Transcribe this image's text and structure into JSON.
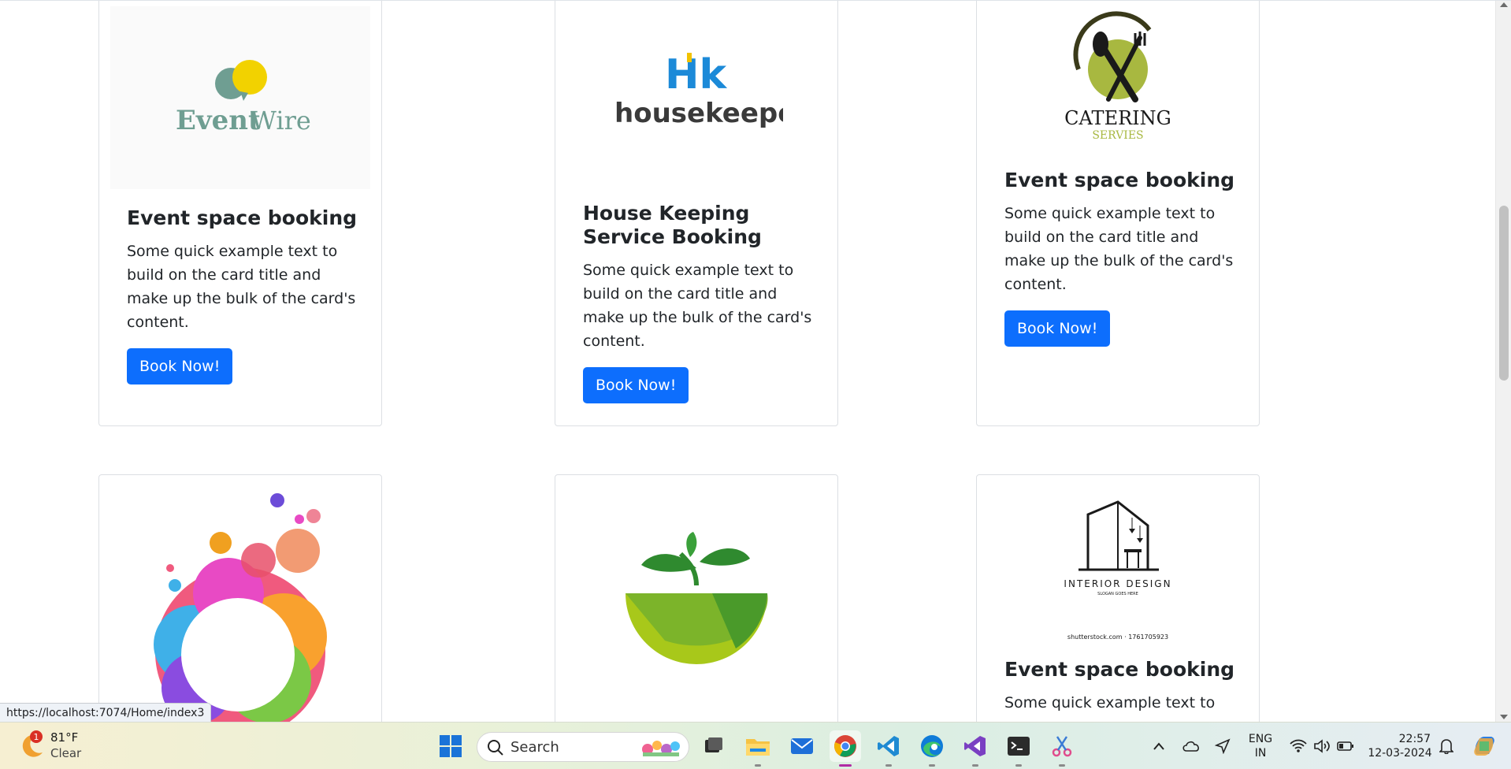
{
  "cards": [
    {
      "title": "Event space booking",
      "text": "Some quick example text to build on the card title and make up the bulk of the card's content.",
      "button": "Book Now!",
      "logo": "EventWire",
      "logo_a": "Event",
      "logo_b": "Wire"
    },
    {
      "title": "House Keeping Service Booking",
      "text": "Some quick example text to build on the card title and make up the bulk of the card's content.",
      "button": "Book Now!",
      "logo_mark": "Hk",
      "logo": "housekeeper"
    },
    {
      "title": "Event space booking",
      "text": "Some quick example text to build on the card title and make up the bulk of the card's content.",
      "button": "Book Now!",
      "logo": "CATERING",
      "logo_sub": "SERVIES"
    },
    {
      "logo": "colorful-circle-art"
    },
    {
      "logo": "green-sprout-field"
    },
    {
      "title": "Event space booking",
      "text": "Some quick example text to",
      "logo": "INTERIOR DESIGN",
      "logo_sub": "SLOGAN GOES HERE",
      "caption": "shutterstock.com · 1761705923"
    }
  ],
  "status_url": "https://localhost:7074/Home/index3",
  "taskbar": {
    "weather": {
      "badge": "1",
      "temp": "81°F",
      "cond": "Clear"
    },
    "search_label": "Search",
    "lang": "ENG",
    "region": "IN",
    "time": "22:57",
    "date": "12-03-2024"
  },
  "colors": {
    "accent": "#0d6efd",
    "chrome_active": "#b02ba4"
  }
}
